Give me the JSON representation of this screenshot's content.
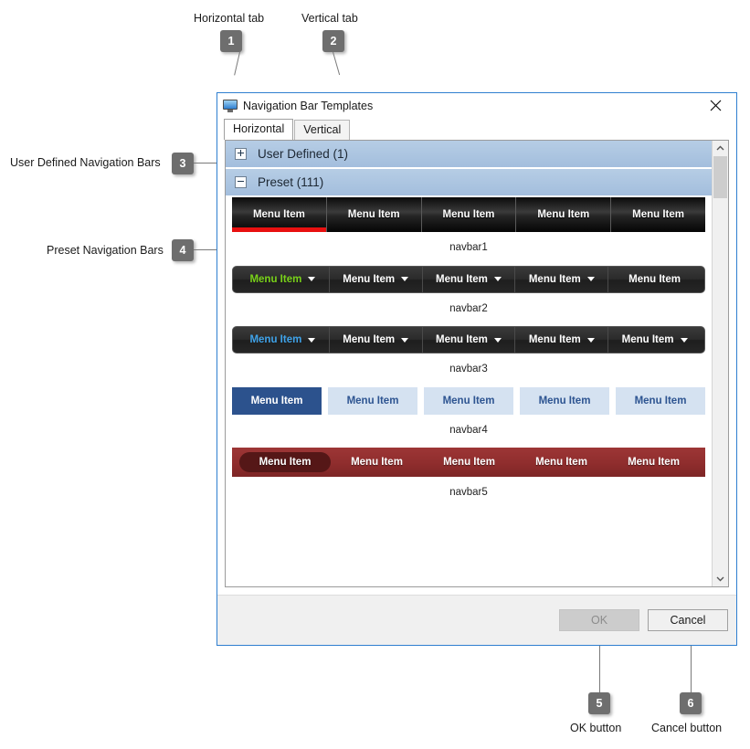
{
  "annotations": [
    {
      "num": "1",
      "label": "Horizontal tab"
    },
    {
      "num": "2",
      "label": "Vertical tab"
    },
    {
      "num": "3",
      "label": "User Defined Navigation Bars"
    },
    {
      "num": "4",
      "label": "Preset Navigation Bars"
    },
    {
      "num": "5",
      "label": "OK button"
    },
    {
      "num": "6",
      "label": "Cancel button"
    }
  ],
  "dialog": {
    "title": "Navigation Bar Templates",
    "icon": "monitor-icon",
    "close_icon": "close-icon",
    "tabs": [
      {
        "label": "Horizontal",
        "selected": true
      },
      {
        "label": "Vertical",
        "selected": false
      }
    ],
    "groups": [
      {
        "label": "User Defined (1)",
        "expanded": false,
        "expander_icon": "plus-icon"
      },
      {
        "label": "Preset (111)",
        "expanded": true,
        "expander_icon": "minus-icon"
      }
    ],
    "item_label": "Menu Item",
    "previews": [
      {
        "caption": "navbar1",
        "style": "glossy-black-red-underline",
        "items": 5,
        "selected_index": 0
      },
      {
        "caption": "navbar2",
        "style": "charcoal-green-dropdown",
        "items": 5,
        "selected_index": 0
      },
      {
        "caption": "navbar3",
        "style": "charcoal-blue-dropdown",
        "items": 5,
        "selected_index": 0
      },
      {
        "caption": "navbar4",
        "style": "flat-blue-buttons",
        "items": 5,
        "selected_index": 0
      },
      {
        "caption": "navbar5",
        "style": "dark-red-pill",
        "items": 5,
        "selected_index": 0
      }
    ],
    "scrollbar": {
      "up_icon": "chevron-up-icon",
      "down_icon": "chevron-down-icon"
    },
    "buttons": {
      "ok": {
        "label": "OK",
        "enabled": false
      },
      "cancel": {
        "label": "Cancel",
        "enabled": true
      }
    }
  },
  "colors": {
    "dialog_border": "#2f7fd0",
    "group_header": "#a9c3de",
    "navbar1_accent": "#e81010",
    "navbar2_accent": "#79d219",
    "navbar3_accent": "#3fa3ea",
    "navbar4_accent": "#2c528d",
    "navbar5_bar": "#8f2d2d",
    "marker": "#6e6e6e"
  }
}
